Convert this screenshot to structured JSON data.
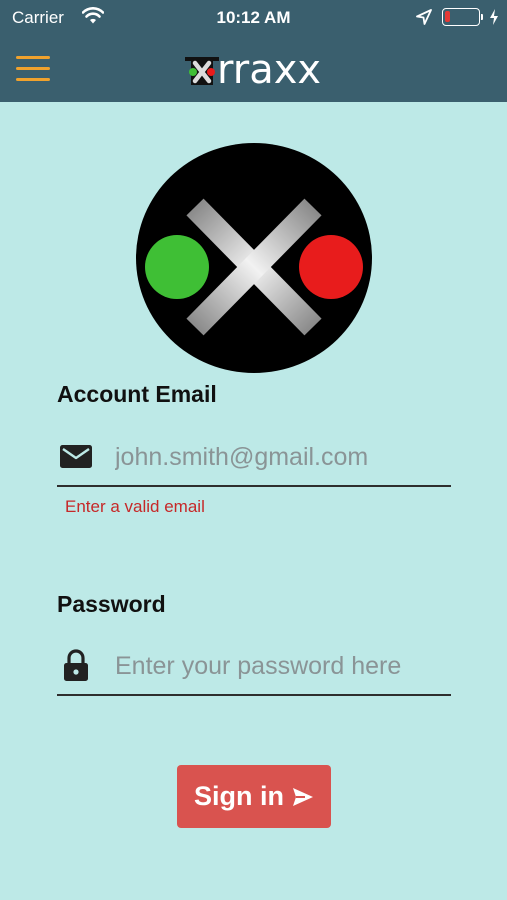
{
  "status_bar": {
    "carrier": "Carrier",
    "time": "10:12 AM",
    "battery_level": 0.15,
    "battery_color": "#e53935"
  },
  "nav": {
    "brand_text": "rraxx",
    "menu_icon": "hamburger-icon",
    "menu_color": "#f0a22d",
    "bar_color": "#3a5f6e"
  },
  "logo": {
    "left_light_color": "#3fbf35",
    "right_light_color": "#e81c1c",
    "background_color": "#000000"
  },
  "form": {
    "email_label": "Account Email",
    "email_placeholder": "john.smith@gmail.com",
    "email_value": "",
    "email_icon": "envelope-icon",
    "email_error": "Enter a valid email",
    "password_label": "Password",
    "password_placeholder": "Enter your password here",
    "password_value": "",
    "password_icon": "lock-icon"
  },
  "actions": {
    "signin_label": "Sign in",
    "signin_icon": "send-icon",
    "signin_color": "#d9534f"
  },
  "page": {
    "background": "#bde9e7"
  }
}
